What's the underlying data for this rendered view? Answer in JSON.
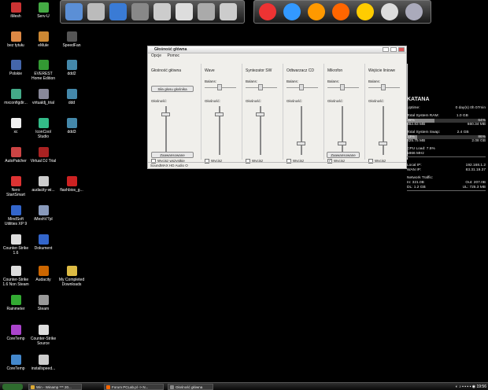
{
  "desktop_icons": [
    {
      "label": "iMesh",
      "color": "#c33"
    },
    {
      "label": "Serv-U",
      "color": "#4a4"
    },
    {
      "label": "bez tytułu",
      "color": "#d84"
    },
    {
      "label": "eMule",
      "color": "#c83"
    },
    {
      "label": "SpeedFan",
      "color": "#555"
    },
    {
      "label": "Polskie",
      "color": "#46a"
    },
    {
      "label": "EVEREST Home Edition",
      "color": "#393"
    },
    {
      "label": "ddd2",
      "color": "#48a"
    },
    {
      "label": "mxconfigdir...",
      "color": "#4a8"
    },
    {
      "label": "virtualdj_trial",
      "color": "#889"
    },
    {
      "label": "ddd",
      "color": "#48a"
    },
    {
      "label": "xc",
      "color": "#eee"
    },
    {
      "label": "IconCool Studio",
      "color": "#3b8"
    },
    {
      "label": "ddd3",
      "color": "#48a"
    },
    {
      "label": "AutoPatcher",
      "color": "#c44"
    },
    {
      "label": "Virtual DJ Trial",
      "color": "#a22"
    },
    {
      "label": "Nero StartSmart",
      "color": "#d33"
    },
    {
      "label": "audacity-wi...",
      "color": "#ccc"
    },
    {
      "label": "flashbios_g...",
      "color": "#c22"
    },
    {
      "label": "MindSoft Utilities XP 9",
      "color": "#36c"
    },
    {
      "label": "iMeshV7pl",
      "color": "#89b"
    },
    {
      "label": "Counter-Strike 1.6",
      "color": "#ddd"
    },
    {
      "label": "Dokument",
      "color": "#36c"
    },
    {
      "label": "Counter-Strike 1.6 Non Steam",
      "color": "#ddd"
    },
    {
      "label": "Audacity",
      "color": "#c60"
    },
    {
      "label": "My Completed Downloads",
      "color": "#db4"
    },
    {
      "label": "Rainmeter",
      "color": "#3a3"
    },
    {
      "label": "Steam",
      "color": "#999"
    },
    {
      "label": "CoreTemp",
      "color": "#a4c"
    },
    {
      "label": "Counter-Strike Source",
      "color": "#ddd"
    },
    {
      "label": "CoreTemp",
      "color": "#48c"
    },
    {
      "label": "installspeed...",
      "color": "#ccc"
    }
  ],
  "dock": {
    "left": [
      {
        "name": "computer",
        "color": "#5b8fd6"
      },
      {
        "name": "drive",
        "color": "#bbb"
      },
      {
        "name": "home",
        "color": "#3a7bd5"
      },
      {
        "name": "network",
        "color": "#888"
      },
      {
        "name": "documents",
        "color": "#ccc"
      },
      {
        "name": "music",
        "color": "#ddd"
      },
      {
        "name": "phone",
        "color": "#aaa"
      },
      {
        "name": "files",
        "color": "#ccc"
      }
    ],
    "right": [
      {
        "name": "burn",
        "color": "#e33"
      },
      {
        "name": "media-player",
        "color": "#39f"
      },
      {
        "name": "flash",
        "color": "#f90"
      },
      {
        "name": "firefox",
        "color": "#f60"
      },
      {
        "name": "smiley",
        "color": "#fc0"
      },
      {
        "name": "mail",
        "color": "#ddd"
      },
      {
        "name": "recycle-bin",
        "color": "#aab"
      }
    ]
  },
  "mixer": {
    "title": "Głośność główna",
    "menu": [
      "Opcje",
      "Pomoc"
    ],
    "balance_label": "Balans:",
    "volume_label": "Głośność:",
    "mute_all_label": "Wycisz wszystkie",
    "mute_label": "Wycisz",
    "advanced_label": "Zaawansowane",
    "speaker_button": "Siła głosu głośnika",
    "status": "SoundMAX HD Audio O",
    "columns": [
      {
        "title": "Głośność główna",
        "volume": 0.85,
        "muted": false
      },
      {
        "title": "Wave",
        "volume": 0.85,
        "muted": false
      },
      {
        "title": "Syntezator SW",
        "volume": 0.85,
        "muted": false
      },
      {
        "title": "Odtwarzacz CD",
        "volume": 0.2,
        "muted": false
      },
      {
        "title": "Mikrofon",
        "volume": 0.2,
        "muted": true
      },
      {
        "title": "Wejście liniowe",
        "volume": 0.2,
        "muted": false
      }
    ]
  },
  "sysinfo": {
    "host": "KATANA",
    "uptime_label": "Uptime:",
    "uptime": "0 day(s) 0h 07min",
    "ram_label": "Total System RAM:",
    "ram": "1.0 GB",
    "ram_pct": "35%",
    "ram_free_pct": "64%",
    "ram_used": "362.83 MB",
    "ram_free": "660.34 MB",
    "ram_fill": 0.35,
    "swap_label": "Total System Swap:",
    "swap": "2.4 GB",
    "swap_pct": "13%",
    "swap_free_pct": "86%",
    "swap_used": "325.75 MB",
    "swap_free": "2.08 GB",
    "swap_fill": 0.13,
    "cpu_label": "CPU Load: 7.5%",
    "cpu_freq": "1866 MHz",
    "local_ip_label": "Local IP:",
    "local_ip": "192.168.1.2",
    "wan_ip_label": "WAN IP:",
    "wan_ip": "83.31.19.37",
    "net_label": "Network Traffic:",
    "in": "In: 321.0B",
    "out": "Out: 207.0B",
    "dl": "DL: 1.2 GB",
    "ul": "UL: 725.3 MB"
  },
  "taskbar": {
    "items": [
      {
        "label": "Win - Winamp *** 20...",
        "color": "#da3"
      },
      {
        "label": "Forum PCLab.pl -> N...",
        "color": "#f60"
      },
      {
        "label": "Głośność główna",
        "color": "#888"
      }
    ],
    "clock": "19:56"
  }
}
